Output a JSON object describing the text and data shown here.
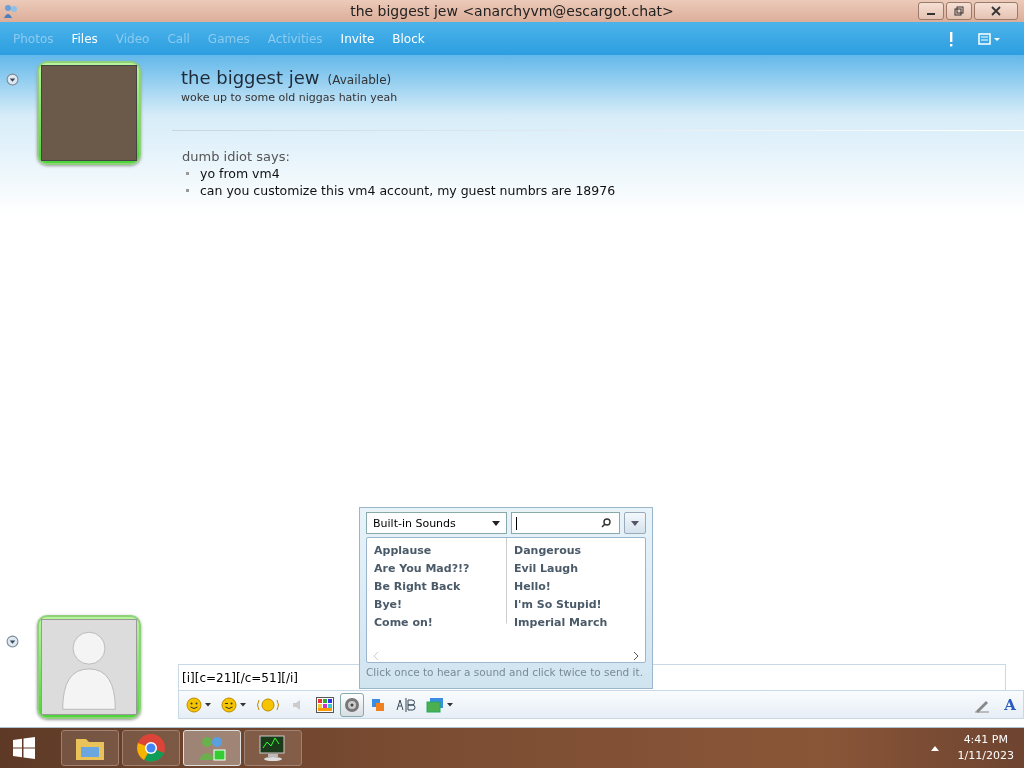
{
  "window": {
    "title": "the biggest jew <anarchyvm@escargot.chat>"
  },
  "menu": [
    {
      "label": "Photos",
      "disabled": true
    },
    {
      "label": "Files",
      "disabled": false
    },
    {
      "label": "Video",
      "disabled": true
    },
    {
      "label": "Call",
      "disabled": true
    },
    {
      "label": "Games",
      "disabled": true
    },
    {
      "label": "Activities",
      "disabled": true
    },
    {
      "label": "Invite",
      "disabled": false
    },
    {
      "label": "Block",
      "disabled": false
    }
  ],
  "contact": {
    "name": "the biggest jew",
    "status": "(Available)",
    "personal_message": "woke up to some old niggas hatin yeah"
  },
  "conversation": {
    "sender": "dumb idiot says:",
    "messages": [
      "yo from vm4",
      "can you customize this vm4 account, my guest numbrs are 18976"
    ]
  },
  "sounds_panel": {
    "category": "Built-in Sounds",
    "sounds": [
      {
        "label": "Applause"
      },
      {
        "label": "Are You Mad?!?"
      },
      {
        "label": "Be Right Back"
      },
      {
        "label": "Bye!"
      },
      {
        "label": "Come on!"
      },
      {
        "label": "Dangerous"
      },
      {
        "label": "Evil Laugh"
      },
      {
        "label": "Hello!"
      },
      {
        "label": "I'm So Stupid!"
      },
      {
        "label": "Imperial March"
      }
    ],
    "hint": "Click once to hear a sound and click twice to send it."
  },
  "compose": {
    "value": "[i][c=21][/c=51][/i]"
  },
  "font_button": "A",
  "compose_toolbar": [
    {
      "kind": "emoticon",
      "selected": false
    },
    {
      "kind": "wink",
      "selected": false
    },
    {
      "kind": "nudge",
      "selected": false
    },
    {
      "kind": "voice",
      "selected": false
    },
    {
      "kind": "palette",
      "selected": false
    },
    {
      "kind": "sound",
      "selected": true
    },
    {
      "kind": "app",
      "selected": false
    },
    {
      "kind": "translate",
      "selected": false
    },
    {
      "kind": "background",
      "selected": false
    }
  ],
  "taskbar": {
    "apps": [
      {
        "kind": "folder",
        "active": false
      },
      {
        "kind": "browser",
        "active": false
      },
      {
        "kind": "messenger",
        "active": true
      },
      {
        "kind": "monitor",
        "active": false
      }
    ],
    "time": "4:41 PM",
    "date": "1/11/2023"
  }
}
